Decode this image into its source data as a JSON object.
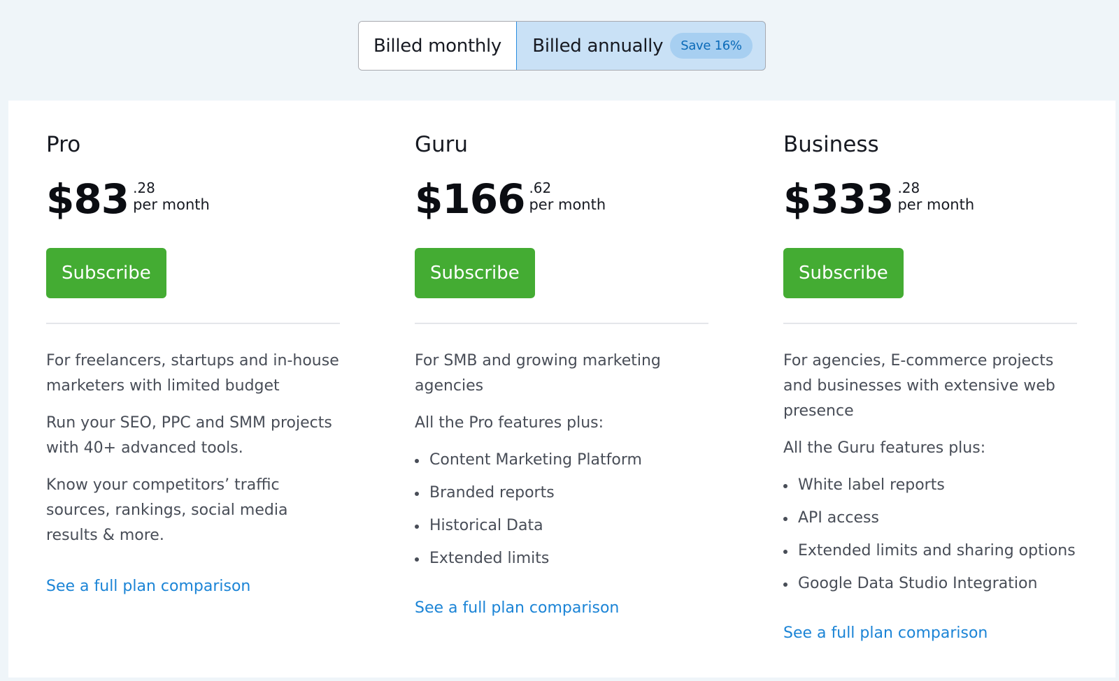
{
  "billing": {
    "monthly_label": "Billed monthly",
    "annual_label": "Billed annually",
    "save_badge": "Save 16%"
  },
  "plans": [
    {
      "name": "Pro",
      "price_whole": "$83",
      "price_cents": ".28",
      "period": "per month",
      "subscribe_label": "Subscribe",
      "paragraphs": [
        "For freelancers, startups and in-house marketers with limited budget",
        "Run your SEO, PPC and SMM projects with 40+ advanced tools.",
        "Know your competitors’ traffic sources, rankings, social media results & more."
      ],
      "compare_link": "See a full plan comparison"
    },
    {
      "name": "Guru",
      "price_whole": "$166",
      "price_cents": ".62",
      "period": "per month",
      "subscribe_label": "Subscribe",
      "paragraphs": [
        "For SMB and growing marketing agencies",
        "All the Pro features plus:"
      ],
      "features": [
        "Content Marketing Platform",
        "Branded reports",
        "Historical Data",
        "Extended limits"
      ],
      "compare_link": "See a full plan comparison"
    },
    {
      "name": "Business",
      "price_whole": "$333",
      "price_cents": ".28",
      "period": "per month",
      "subscribe_label": "Subscribe",
      "paragraphs": [
        "For agencies, E-commerce projects and businesses with extensive web presence",
        "All the Guru features plus:"
      ],
      "features": [
        "White label reports",
        "API access",
        "Extended limits and sharing options",
        "Google Data Studio Integration"
      ],
      "compare_link": "See a full plan comparison"
    }
  ]
}
